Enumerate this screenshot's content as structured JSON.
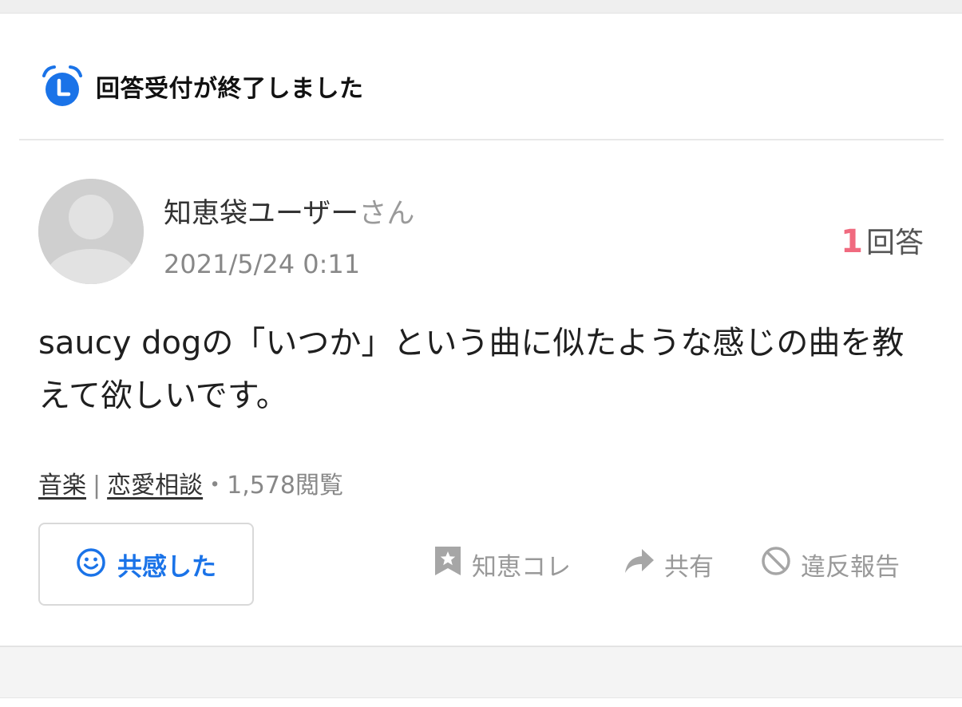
{
  "status": {
    "closed_text": "回答受付が終了しました",
    "icon": "alarm-clock-icon"
  },
  "user": {
    "name": "知恵袋ユーザー",
    "suffix": "さん",
    "date": "2021/5/24 0:11",
    "avatar_icon": "default-avatar-icon"
  },
  "answers": {
    "count": "1",
    "label": "回答"
  },
  "question": {
    "text": "saucy dogの「いつか」という曲に似たような感じの曲を教えて欲しいです。"
  },
  "meta": {
    "category_1": "音楽",
    "separator": "|",
    "category_2": "恋愛相談",
    "views": "・1,578閲覧"
  },
  "actions": {
    "empathy_label": "共感した",
    "empathy_icon": "smile-icon",
    "chiebukuro_label": "知恵コレ",
    "chiebukuro_icon": "bookmark-star-icon",
    "share_label": "共有",
    "share_icon": "share-arrow-icon",
    "report_label": "違反報告",
    "report_icon": "prohibited-icon"
  },
  "colors": {
    "accent_blue": "#1a73e8",
    "answer_count_pink": "#f06a7f",
    "muted_gray": "#999999"
  }
}
